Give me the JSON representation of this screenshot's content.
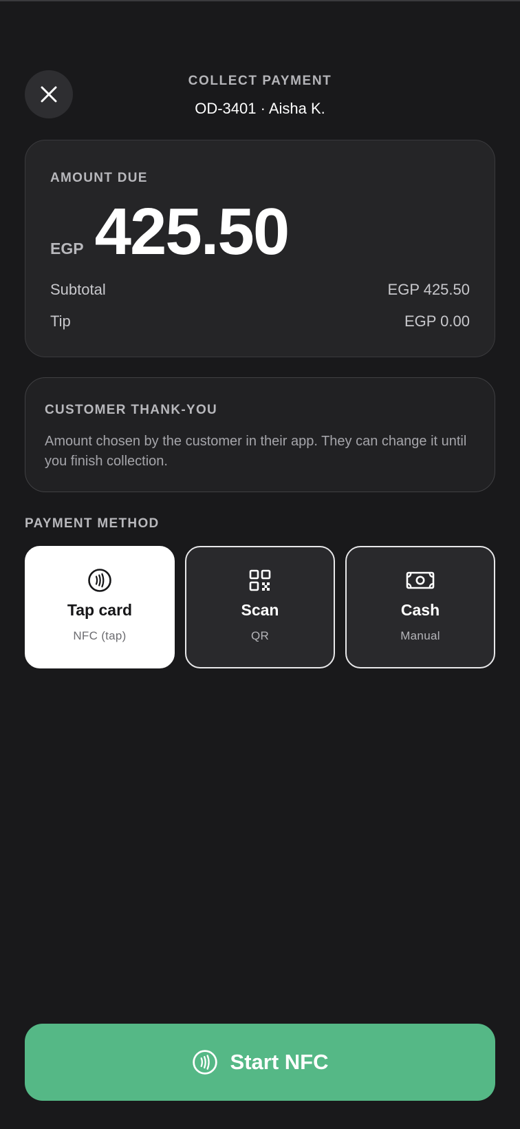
{
  "header": {
    "title": "COLLECT PAYMENT",
    "subtitle": "OD-3401 · Aisha K."
  },
  "close_button": {
    "icon": "close-icon"
  },
  "amount_card": {
    "label": "AMOUNT DUE",
    "currency": "EGP",
    "amount": "425.50",
    "rows": [
      {
        "label": "Subtotal",
        "value": "EGP 425.50"
      },
      {
        "label": "Tip",
        "value": "EGP 0.00"
      }
    ]
  },
  "thanks_card": {
    "title": "CUSTOMER THANK-YOU",
    "body": "Amount chosen by the customer in their app. They can change it until you finish collection."
  },
  "payment": {
    "label": "PAYMENT METHOD",
    "methods": [
      {
        "name": "Tap card",
        "sub": "NFC (tap)",
        "icon": "nfc-icon",
        "selected": true
      },
      {
        "name": "Scan",
        "sub": "QR",
        "icon": "qr-code-icon",
        "selected": false
      },
      {
        "name": "Cash",
        "sub": "Manual",
        "icon": "banknote-icon",
        "selected": false
      }
    ]
  },
  "start_button": {
    "label": "Start NFC",
    "icon": "nfc-icon"
  },
  "colors": {
    "background": "#19191b",
    "card": "#252527",
    "accent_green": "#55b886",
    "selected_method": "#ffffff"
  }
}
